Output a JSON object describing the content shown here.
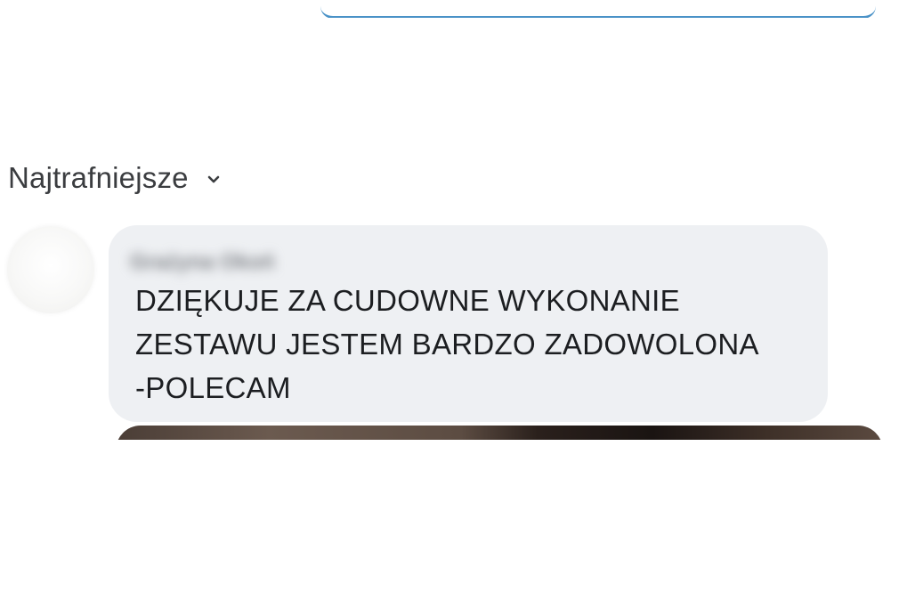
{
  "sort": {
    "label": "Najtrafniejsze",
    "icon": "chevron-down-icon"
  },
  "comment": {
    "author": "Grażyna Okoń",
    "text": "DZIĘKUJE  ZA  CUDOWNE WYKONANIE\nZESTAWU JESTEM BARDZO ZADOWOLONA\n-POLECAM"
  },
  "colors": {
    "bubble": "#eef0f3",
    "top_line": "#4a92c7",
    "text": "#1c1e21"
  }
}
